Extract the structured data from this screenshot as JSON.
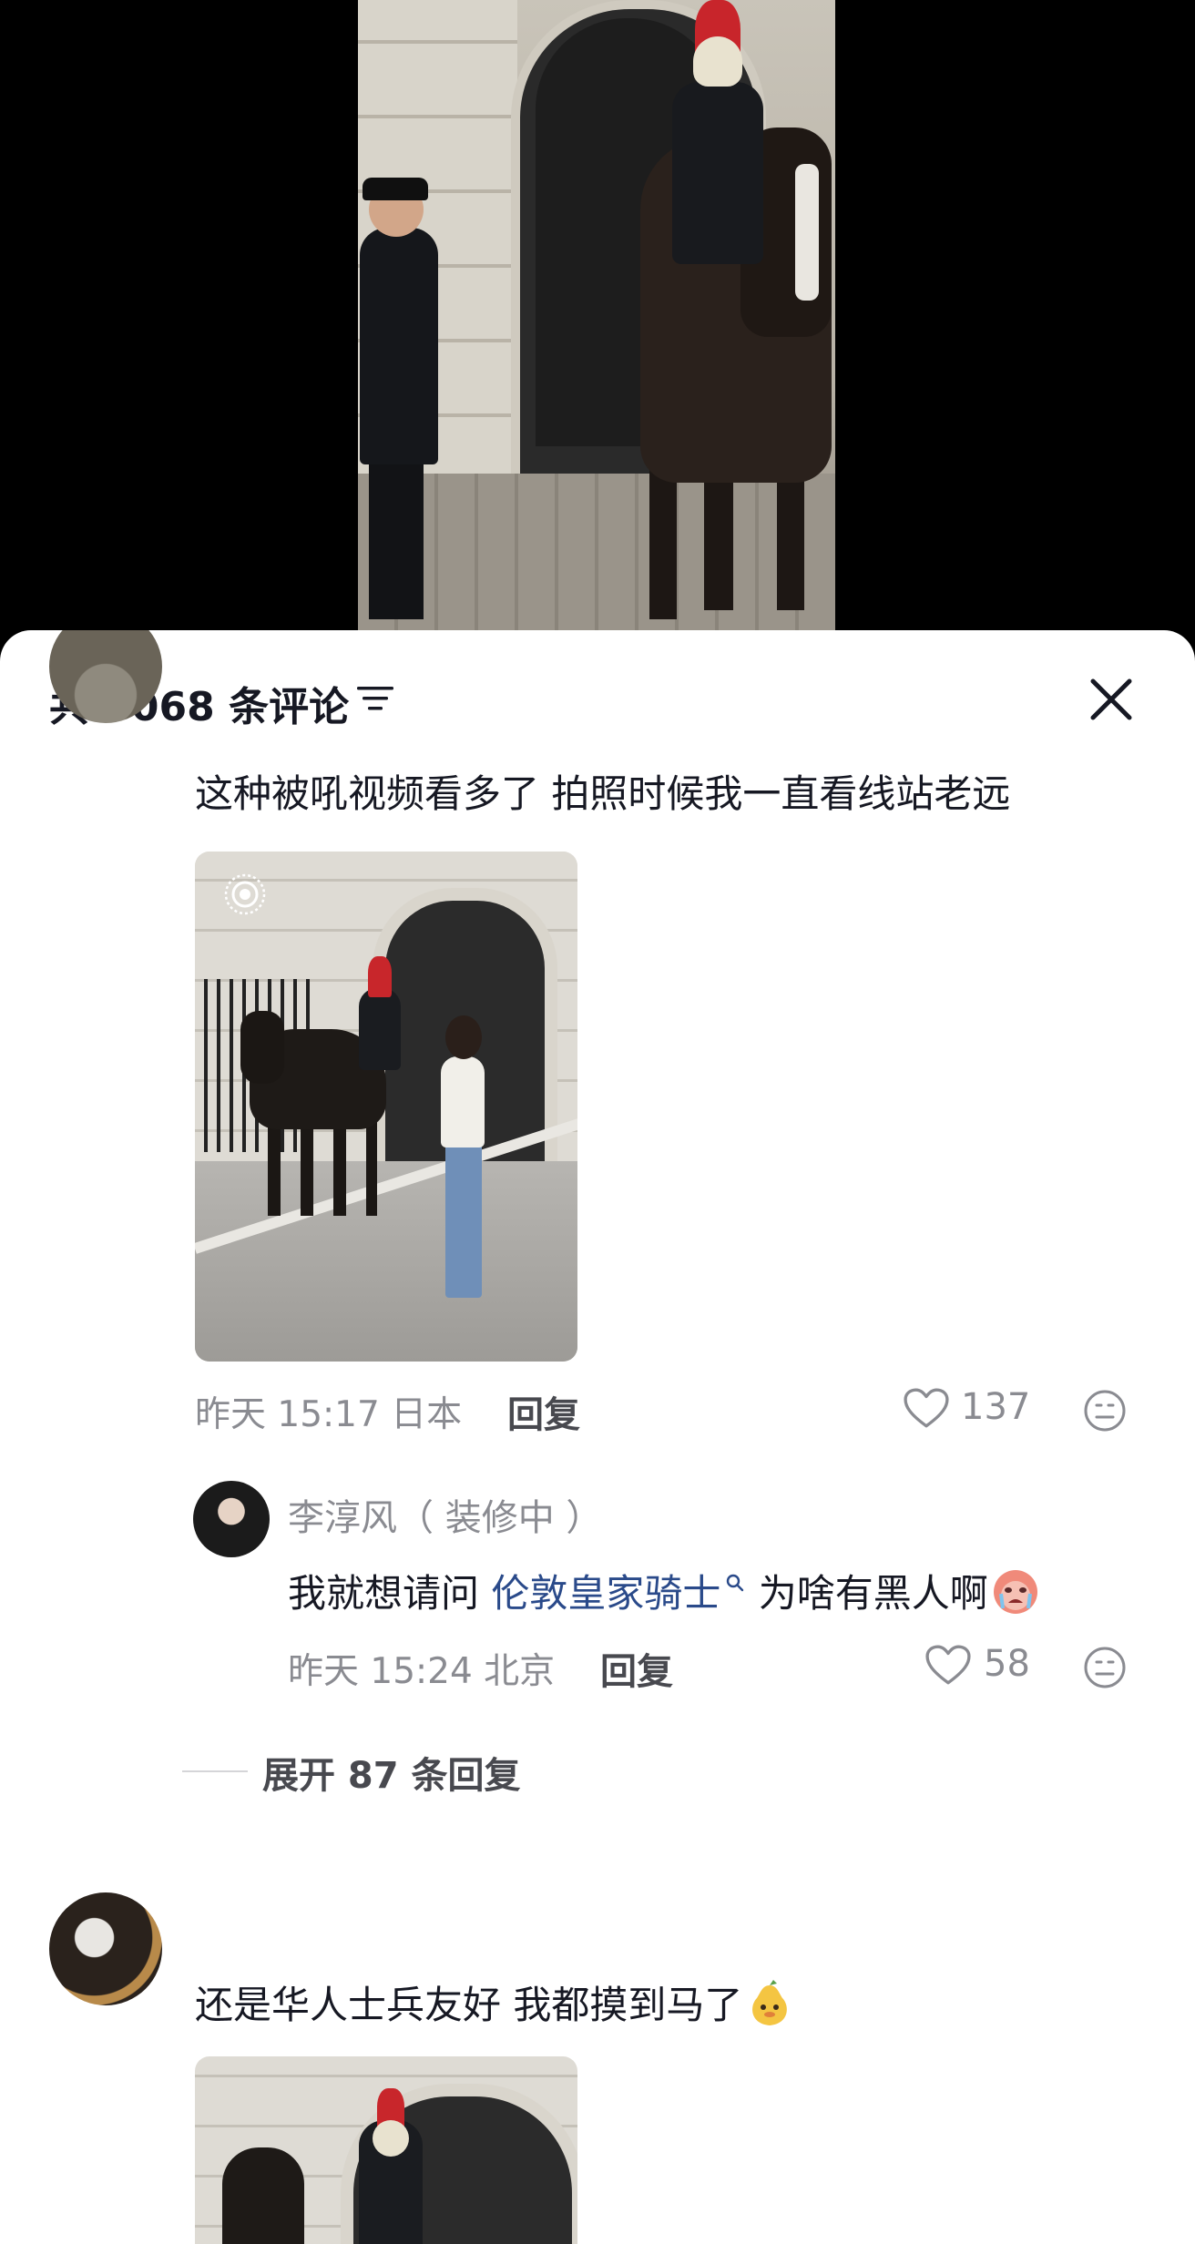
{
  "header": {
    "title": "共 3068 条评论"
  },
  "comments": [
    {
      "text": "这种被吼视频看多了 拍照时候我一直看线站老远",
      "meta": "昨天 15:17 日本",
      "reply_label": "回复",
      "likes": "137",
      "replies": [
        {
          "username": "李淳风（ 装修中 ）",
          "text_before": "我就想请问 ",
          "link_text": "伦敦皇家骑士",
          "text_after": " 为啥有黑人啊",
          "meta": "昨天 15:24 北京",
          "reply_label": "回复",
          "likes": "58"
        }
      ],
      "expand_label": "展开 87 条回复"
    },
    {
      "username": "",
      "text": "还是华人士兵友好 我都摸到马了"
    }
  ],
  "colors": {
    "accent_link": "#2a4a8a",
    "meta_gray": "#8a8b91"
  }
}
